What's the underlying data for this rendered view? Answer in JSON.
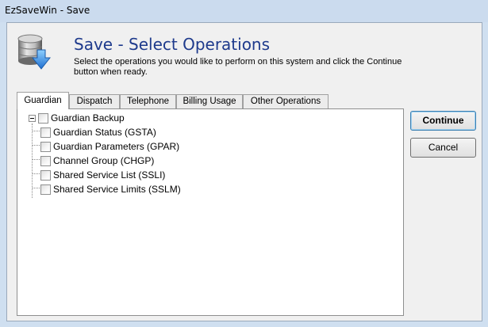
{
  "window": {
    "title": "EzSaveWin - Save"
  },
  "header": {
    "heading": "Save - Select Operations",
    "description": "Select the operations you would like to perform on this system and click the Continue button when ready.",
    "icon": "database-save-icon"
  },
  "tabs": [
    {
      "label": "Guardian",
      "active": true
    },
    {
      "label": "Dispatch",
      "active": false
    },
    {
      "label": "Telephone",
      "active": false
    },
    {
      "label": "Billing Usage",
      "active": false
    },
    {
      "label": "Other Operations",
      "active": false
    }
  ],
  "tree": {
    "root": {
      "label": "Guardian Backup",
      "expanded": true,
      "checked": false
    },
    "children": [
      {
        "label": "Guardian Status (GSTA)",
        "checked": false
      },
      {
        "label": "Guardian Parameters (GPAR)",
        "checked": false
      },
      {
        "label": "Channel Group (CHGP)",
        "checked": false
      },
      {
        "label": "Shared Service List (SSLI)",
        "checked": false
      },
      {
        "label": "Shared Service Limits (SSLM)",
        "checked": false
      }
    ]
  },
  "buttons": {
    "continue": "Continue",
    "cancel": "Cancel"
  }
}
